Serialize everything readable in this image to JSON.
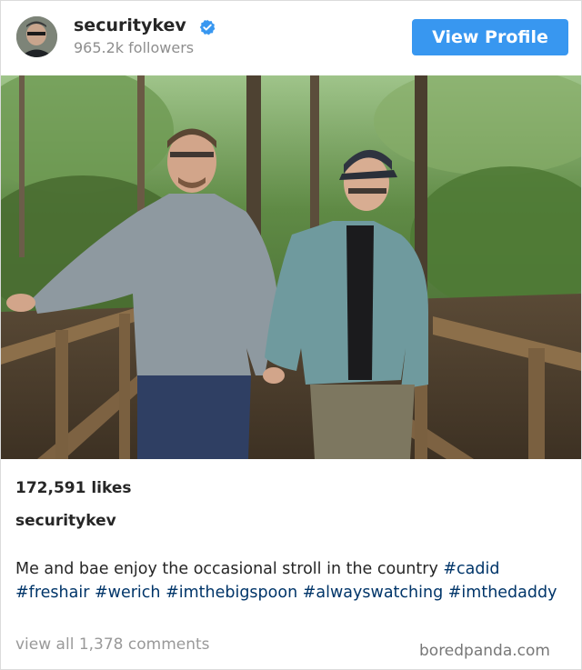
{
  "header": {
    "username": "securitykev",
    "followers": "965.2k followers",
    "view_profile_label": "View Profile"
  },
  "colors": {
    "button": "#3897f0",
    "verified_badge": "#3897f0",
    "hashtag": "#003569"
  },
  "post": {
    "likes": "172,591 likes",
    "caption_username": "securitykev",
    "caption_text": "Me and bae enjoy the occasional stroll in the country",
    "hashtags": [
      "#cadid",
      "#freshair",
      "#werich",
      "#imthebigspoon",
      "#alwayswatching",
      "#imthedaddy"
    ],
    "comments_link": "view all 1,378 comments"
  },
  "watermark": "boredpanda.com",
  "icons": {
    "verified": "verified-badge-icon"
  }
}
